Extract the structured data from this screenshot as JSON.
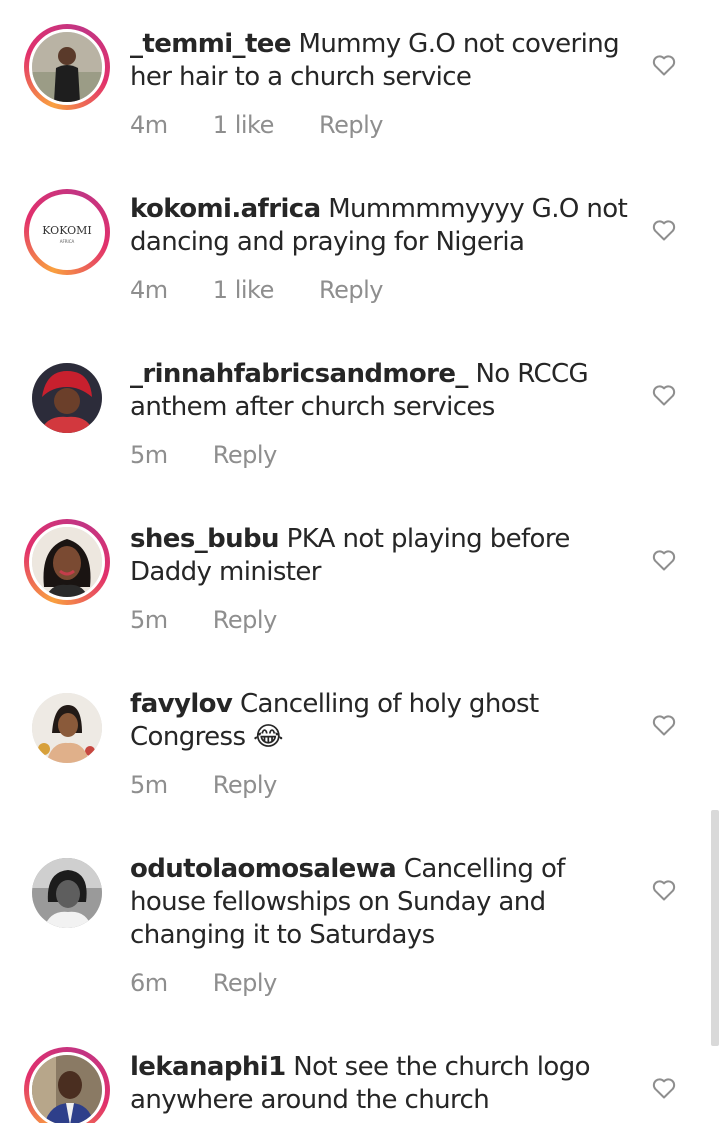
{
  "comments": [
    {
      "username": "_temmi_tee",
      "text": "Mummy G.O not covering her hair to a church service",
      "time": "4m",
      "likes": "1 like",
      "reply": "Reply",
      "avatar_icon": "person-photo-icon",
      "story_ring": true
    },
    {
      "username": "kokomi.africa",
      "text": "Mummmmyyyy G.O not dancing and praying for Nigeria",
      "time": "4m",
      "likes": "1 like",
      "reply": "Reply",
      "avatar_logo_text": "KOKOMI",
      "avatar_logo_sub": "AFRICA",
      "story_ring": true
    },
    {
      "username": "_rinnahfabricsandmore_",
      "text": "No RCCG anthem after church services",
      "time": "5m",
      "likes": "",
      "reply": "Reply",
      "avatar_icon": "person-photo-icon",
      "story_ring": false
    },
    {
      "username": "shes_bubu",
      "text": "PKA not playing before Daddy minister",
      "time": "5m",
      "likes": "",
      "reply": "Reply",
      "avatar_icon": "person-photo-icon",
      "story_ring": true
    },
    {
      "username": "favylov",
      "text": "Cancelling of holy ghost Congress",
      "emoji": "😂",
      "time": "5m",
      "likes": "",
      "reply": "Reply",
      "avatar_icon": "person-photo-icon",
      "story_ring": false
    },
    {
      "username": "odutolaomosalewa",
      "text": "Cancelling of house fellowships on Sunday and changing it to Saturdays",
      "time": "6m",
      "likes": "",
      "reply": "Reply",
      "avatar_icon": "person-photo-icon",
      "story_ring": false
    },
    {
      "username": "lekanaphi1",
      "text": "Not see the church logo anywhere around the church",
      "time": "",
      "likes": "",
      "reply": "",
      "avatar_icon": "person-photo-icon",
      "story_ring": true
    }
  ],
  "colors": {
    "text": "#262626",
    "meta": "#8e8e8e",
    "heart_outline": "#8e8e8e",
    "story_ring_start": "#f9a03f",
    "story_ring_end": "#c13584"
  }
}
